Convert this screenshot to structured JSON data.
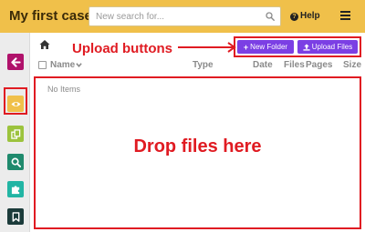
{
  "header": {
    "title": "My first case",
    "search_placeholder": "New search for...",
    "search_icon": "search-icon",
    "help_label": "Help",
    "help_icon": "question-circle-icon",
    "menu_icon": "hamburger-menu-icon",
    "background_color": "#f0c04a"
  },
  "sidebar": {
    "items": [
      {
        "icon": "arrow-left-icon",
        "color": "#b0126b"
      },
      {
        "icon": "eye-icon",
        "color": "#f0c04a"
      },
      {
        "icon": "copy-icon",
        "color": "#9cc33d"
      },
      {
        "icon": "search-icon",
        "color": "#1f8a6d"
      },
      {
        "icon": "puzzle-icon",
        "color": "#22b5a4"
      },
      {
        "icon": "bookmark-icon",
        "color": "#1b3b3a"
      }
    ]
  },
  "annotations": {
    "upload_buttons": "Upload buttons",
    "drop_files": "Drop files here",
    "color": "#e01b22"
  },
  "toolbar": {
    "home_icon": "home-icon",
    "new_folder_label": "New Folder",
    "upload_files_label": "Upload Files",
    "button_color": "#7b3fe4"
  },
  "table": {
    "columns": [
      "Name",
      "Type",
      "Date",
      "Files",
      "Pages",
      "Size"
    ],
    "empty_text": "No Items"
  }
}
